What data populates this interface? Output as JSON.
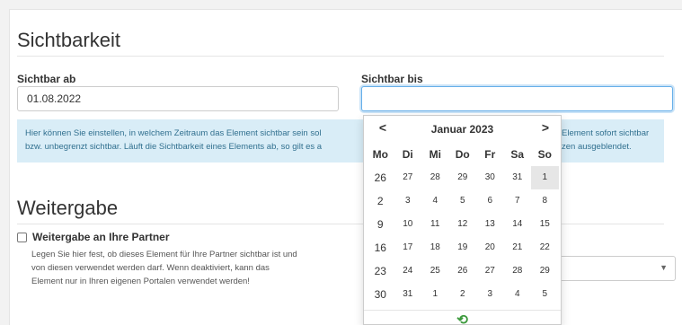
{
  "visibility": {
    "title": "Sichtbarkeit",
    "from_label": "Sichtbar ab",
    "from_value": "01.08.2022",
    "until_label": "Sichtbar bis",
    "until_value": "",
    "info_left_line1": "Hier können Sie einstellen, in welchem Zeitraum das Element sichtbar sein sol",
    "info_left_line2": "bzw. unbegrenzt sichtbar. Läuft die Sichtbarkeit eines Elements ab, so gilt es a",
    "info_right_line1": "Element sofort sichtbar",
    "info_right_line2": "zen ausgeblendet."
  },
  "datepicker": {
    "prev_icon": "chevron-left-icon",
    "next_icon": "chevron-right-icon",
    "prev_symbol": "<",
    "next_symbol": ">",
    "month_title": "Januar 2023",
    "week_label": "Mo",
    "weekdays": [
      "Di",
      "Mi",
      "Do",
      "Fr",
      "Sa",
      "So"
    ],
    "weeks": [
      {
        "week": "26",
        "days": [
          "27",
          "28",
          "29",
          "30",
          "31",
          "1"
        ]
      },
      {
        "week": "2",
        "days": [
          "3",
          "4",
          "5",
          "6",
          "7",
          "8"
        ]
      },
      {
        "week": "9",
        "days": [
          "10",
          "11",
          "12",
          "13",
          "14",
          "15"
        ]
      },
      {
        "week": "16",
        "days": [
          "17",
          "18",
          "19",
          "20",
          "21",
          "22"
        ]
      },
      {
        "week": "23",
        "days": [
          "24",
          "25",
          "26",
          "27",
          "28",
          "29"
        ]
      },
      {
        "week": "30",
        "days": [
          "31",
          "1",
          "2",
          "3",
          "4",
          "5"
        ]
      }
    ],
    "today_symbol": "⟲",
    "today_icon": "reset-today-icon",
    "accent_color": "#3c9a3c"
  },
  "sharing": {
    "title": "Weitergabe",
    "checkbox_label": "Weitergabe an Ihre Partner",
    "help_line1": "Legen Sie hier fest, ob dieses Element für Ihre Partner sichtbar ist und",
    "help_line2": "von diesen verwendet werden darf. Wenn deaktiviert, kann das",
    "help_line3": "Element nur in Ihren eigenen Portalen verwendet werden!",
    "select_caret": "▼"
  }
}
